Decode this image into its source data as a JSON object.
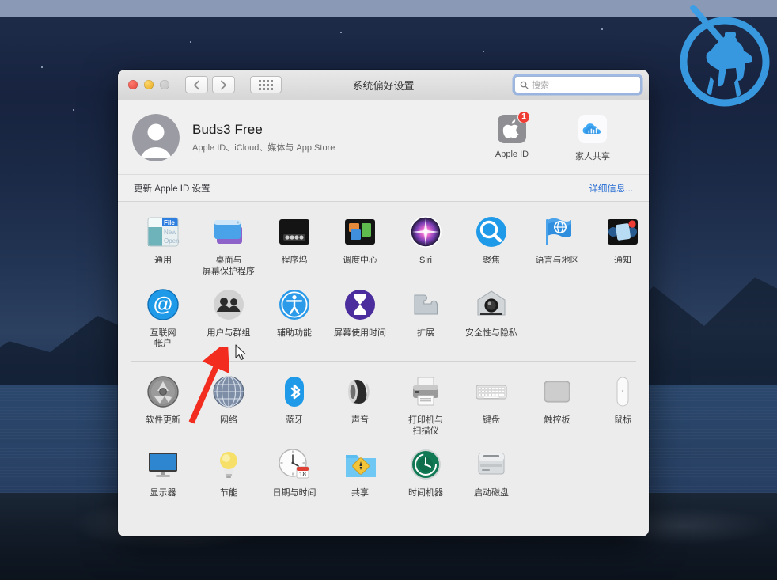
{
  "window": {
    "title": "系统偏好设置",
    "traffic_lights": [
      "close",
      "minimize",
      "zoom"
    ],
    "nav": {
      "back": "‹",
      "forward": "›",
      "show_all": "show-all-grid"
    },
    "search": {
      "placeholder": "搜索",
      "value": ""
    }
  },
  "account": {
    "name": "Buds3 Free",
    "subtitle": "Apple ID、iCloud、媒体与 App Store",
    "items": [
      {
        "label": "Apple ID",
        "icon": "apple-logo-icon",
        "badge": "1"
      },
      {
        "label": "家人共享",
        "icon": "family-sharing-cloud-icon",
        "badge": ""
      }
    ]
  },
  "update_strip": {
    "text": "更新 Apple ID 设置",
    "link": "详细信息..."
  },
  "sections": [
    {
      "name": "section-one",
      "rows": [
        [
          {
            "label": "通用",
            "icon": "general-icon"
          },
          {
            "label": "桌面与\n屏幕保护程序",
            "icon": "desktop-screensaver-icon"
          },
          {
            "label": "程序坞",
            "icon": "dock-icon"
          },
          {
            "label": "调度中心",
            "icon": "mission-control-icon"
          },
          {
            "label": "Siri",
            "icon": "siri-icon"
          },
          {
            "label": "聚焦",
            "icon": "spotlight-icon"
          },
          {
            "label": "语言与地区",
            "icon": "language-region-icon"
          },
          {
            "label": "通知",
            "icon": "notifications-icon"
          }
        ],
        [
          {
            "label": "互联网\n帐户",
            "icon": "internet-accounts-icon"
          },
          {
            "label": "用户与群组",
            "icon": "users-groups-icon"
          },
          {
            "label": "辅助功能",
            "icon": "accessibility-icon"
          },
          {
            "label": "屏幕使用时间",
            "icon": "screen-time-icon"
          },
          {
            "label": "扩展",
            "icon": "extensions-icon"
          },
          {
            "label": "安全性与隐私",
            "icon": "security-privacy-icon"
          }
        ]
      ]
    },
    {
      "name": "section-two",
      "rows": [
        [
          {
            "label": "软件更新",
            "icon": "software-update-icon"
          },
          {
            "label": "网络",
            "icon": "network-icon"
          },
          {
            "label": "蓝牙",
            "icon": "bluetooth-icon"
          },
          {
            "label": "声音",
            "icon": "sound-icon"
          },
          {
            "label": "打印机与\n扫描仪",
            "icon": "printers-scanners-icon"
          },
          {
            "label": "键盘",
            "icon": "keyboard-icon"
          },
          {
            "label": "触控板",
            "icon": "trackpad-icon"
          },
          {
            "label": "鼠标",
            "icon": "mouse-icon"
          }
        ],
        [
          {
            "label": "显示器",
            "icon": "displays-icon"
          },
          {
            "label": "节能",
            "icon": "energy-saver-icon"
          },
          {
            "label": "日期与时间",
            "icon": "date-time-icon"
          },
          {
            "label": "共享",
            "icon": "sharing-icon"
          },
          {
            "label": "时间机器",
            "icon": "time-machine-icon"
          },
          {
            "label": "启动磁盘",
            "icon": "startup-disk-icon"
          }
        ]
      ]
    }
  ],
  "annotations": {
    "arrow": {
      "color": "#f22d20",
      "points_to": "用户与群组"
    },
    "cursor": "arrow-pointer"
  },
  "desktop": {
    "watermark": "knight-on-horseback-logo",
    "watermark_color": "#3a9fe8"
  },
  "colors": {
    "accent_link": "#2a6fd4",
    "badge_red": "#ef3d36",
    "window_bg": "#ececec",
    "titlebar_bg": "#e3e3e3",
    "annotation_red": "#f22d20"
  }
}
